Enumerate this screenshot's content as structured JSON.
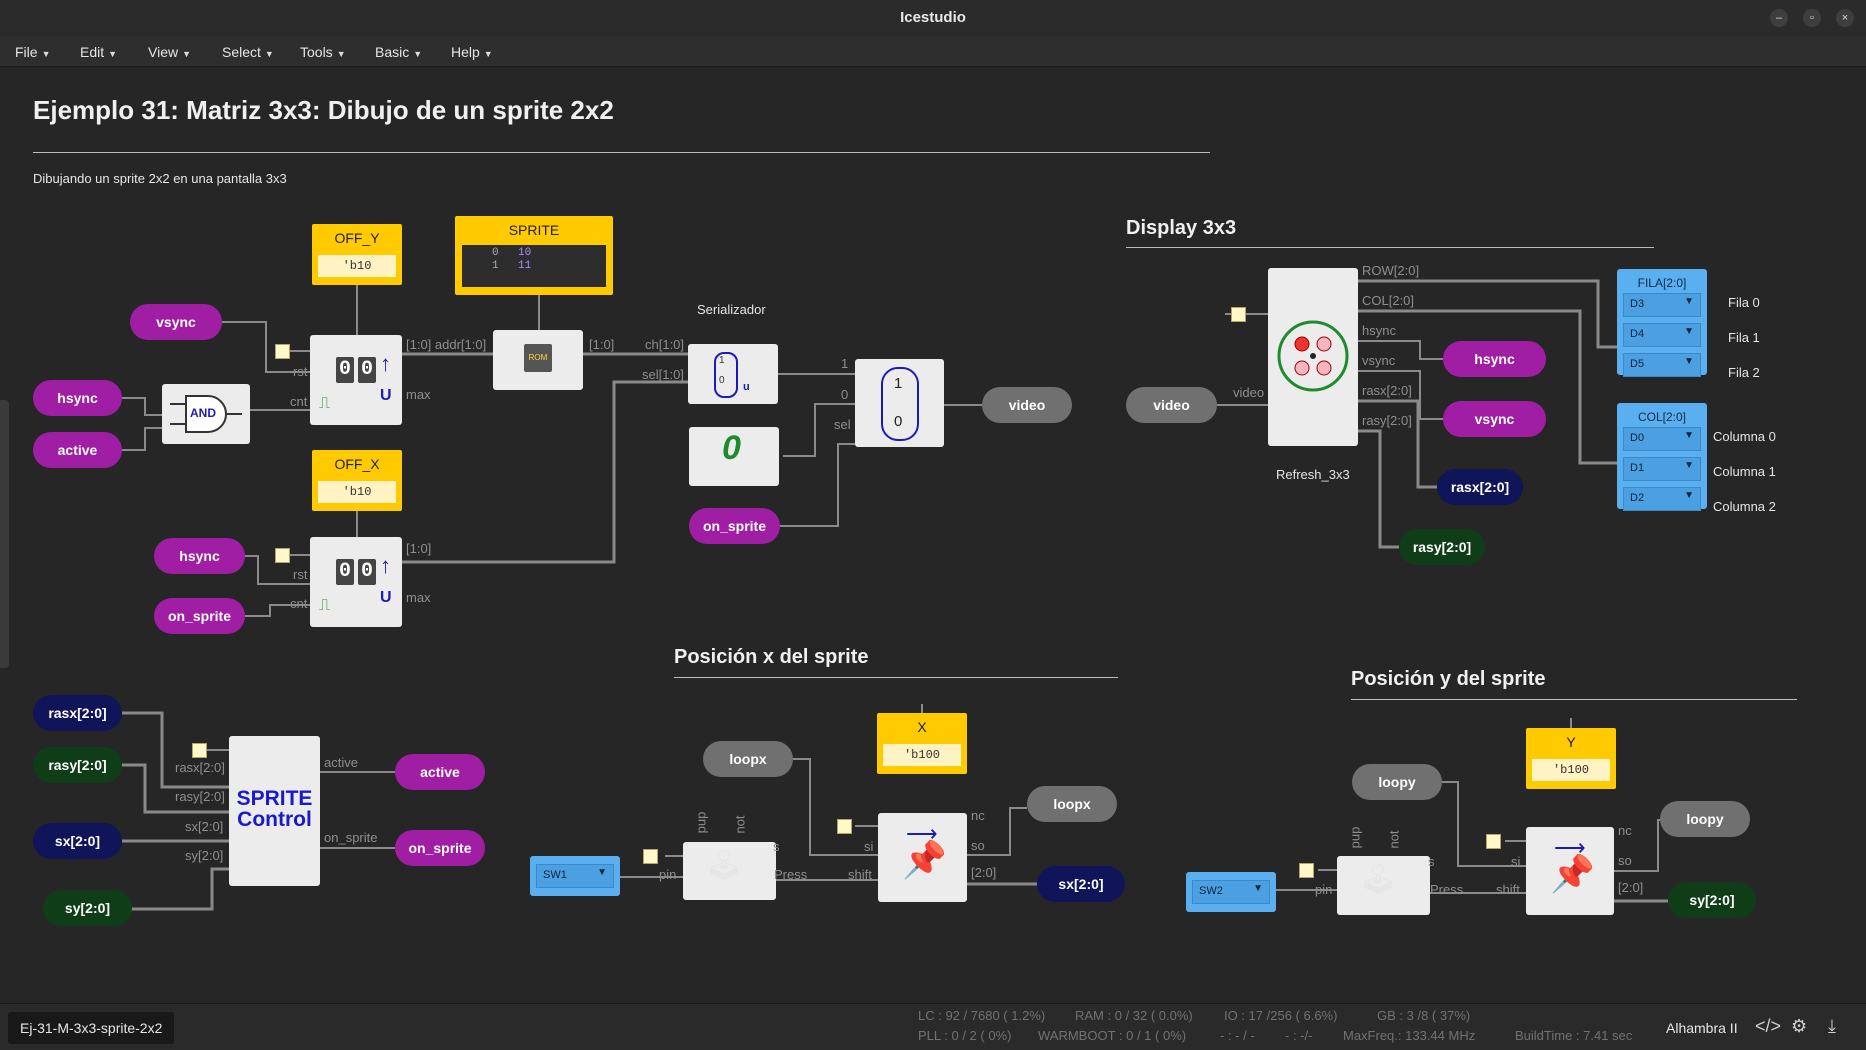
{
  "window": {
    "title": "Icestudio",
    "min_icon": "minimize-icon",
    "max_icon": "restore-icon",
    "close_icon": "close-icon"
  },
  "menu": [
    {
      "label": "File"
    },
    {
      "label": "Edit"
    },
    {
      "label": "View"
    },
    {
      "label": "Select"
    },
    {
      "label": "Tools"
    },
    {
      "label": "Basic"
    },
    {
      "label": "Help"
    }
  ],
  "canvas": {
    "title": "Ejemplo 31: Matriz 3x3: Dibujo de un sprite 2x2",
    "subtitle": "Dibujando un sprite 2x2 en una pantalla 3x3",
    "display_header": "Display 3x3",
    "posx_header": "Posición x del sprite",
    "posy_header": "Posición y del sprite",
    "serializador_label": "Serializador",
    "refresh_label": "Refresh_3x3"
  },
  "params": {
    "off_y": {
      "name": "OFF_Y",
      "value": "'b10"
    },
    "off_x": {
      "name": "OFF_X",
      "value": "'b10"
    },
    "x": {
      "name": "X",
      "value": "'b100"
    },
    "y": {
      "name": "Y",
      "value": "'b100"
    },
    "sprite": {
      "name": "SPRITE",
      "rows": [
        {
          "addr": "0",
          "val": "10"
        },
        {
          "addr": "1",
          "val": "11"
        }
      ]
    }
  },
  "ports": {
    "vsync_in": "vsync",
    "hsync_in": "hsync",
    "active_in": "active",
    "hsync_in2": "hsync",
    "on_sprite_in": "on_sprite",
    "on_sprite_mux": "on_sprite",
    "video_out": "video",
    "video_in": "video",
    "hsync_out": "hsync",
    "vsync_out": "vsync",
    "rasx_out": "rasx[2:0]",
    "rasy_out": "rasy[2:0]",
    "rasx_in": "rasx[2:0]",
    "rasy_in": "rasy[2:0]",
    "sx_in": "sx[2:0]",
    "sy_in": "sy[2:0]",
    "active_out": "active",
    "on_sprite_out": "on_sprite",
    "loopx_in": "loopx",
    "loopx_out": "loopx",
    "sx_out": "sx[2:0]",
    "loopy_in": "loopy",
    "loopy_out": "loopy",
    "sy_out": "sy[2:0]"
  },
  "fpga": {
    "fila": {
      "name": "FILA[2:0]",
      "pins": [
        "D3",
        "D4",
        "D5"
      ],
      "labels": [
        "Fila 0",
        "Fila 1",
        "Fila 2"
      ]
    },
    "col": {
      "name": "COL[2:0]",
      "pins": [
        "D0",
        "D1",
        "D2"
      ],
      "labels": [
        "Columna 0",
        "Columna 1",
        "Columna 2"
      ]
    },
    "sw1": "SW1",
    "sw2": "SW2"
  },
  "wire_labels": {
    "addr": "[1:0] addr[1:0]",
    "rom_out": "[1:0]",
    "ch": "ch[1:0]",
    "sel_bus": "sel[1:0]",
    "mux1": "1",
    "mux0": "0",
    "mux_sel": "sel",
    "cnt_bus": "[1:0]",
    "rst1": "rst",
    "cnt1": "cnt",
    "max1": "max",
    "rst2": "rst",
    "cnt2": "cnt",
    "max2": "max",
    "row": "ROW[2:0]",
    "col": "COL[2:0]",
    "hsync": "hsync",
    "vsync": "vsync",
    "rasx": "rasx[2:0]",
    "rasy": "rasy[2:0]",
    "video": "video",
    "sc_rasx": "rasx[2:0]",
    "sc_rasy": "rasy[2:0]",
    "sc_sx": "sx[2:0]",
    "sc_sy": "sy[2:0]",
    "sc_active": "active",
    "sc_on_sprite": "on_sprite",
    "pup": "pup",
    "not": "not",
    "pin": "pin",
    "s": "s",
    "press": "Press",
    "si": "si",
    "shift": "shift",
    "nc": "nc",
    "so": "so",
    "bus": "[2:0]"
  },
  "blocks": {
    "and_label": "AND",
    "sprite_control": [
      "SPRITE",
      "Control"
    ],
    "mux_top": "1",
    "mux_bottom": "0",
    "ser_top": "1",
    "ser_bottom": "0",
    "ser_u": "u",
    "const_zero": "0",
    "counter_digits": "00",
    "rom_label": "ROM"
  },
  "status": {
    "tab": "Ej-31-M-3x3-sprite-2x2",
    "line1": [
      "LC : 92 / 7680 ( 1.2%)",
      "RAM : 0 / 32 ( 0.0%)",
      "IO : 17 /256 ( 6.6%)",
      "GB : 3 /8 ( 37%)"
    ],
    "line2": [
      "PLL : 0 / 2 ( 0%)",
      "WARMBOOT : 0 / 1 ( 0%)",
      "- : - / -",
      "- : -/-",
      "MaxFreq.: 133.44 MHz",
      "BuildTime : 7.41 sec"
    ],
    "board": "Alhambra II"
  }
}
